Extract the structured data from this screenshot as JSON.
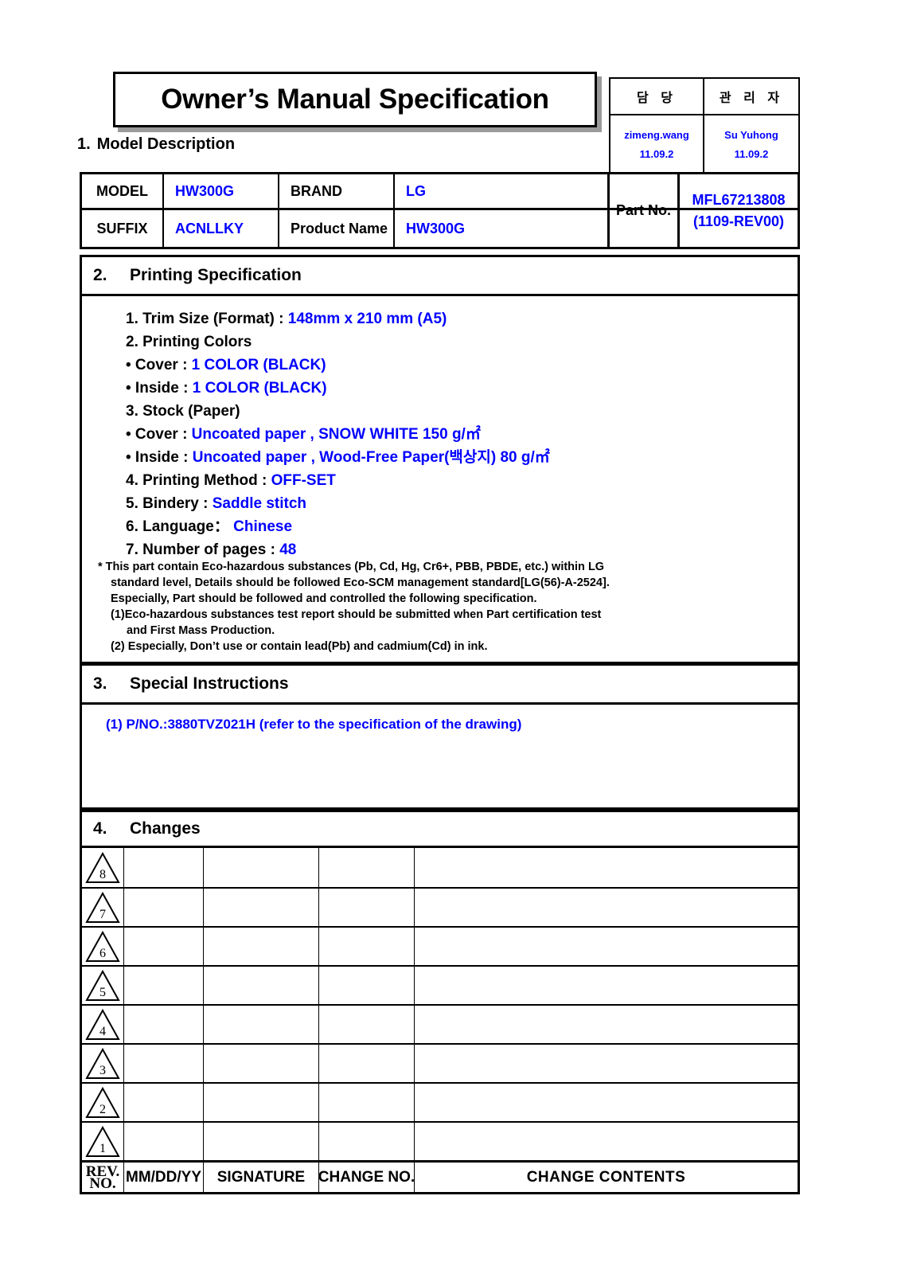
{
  "title": "Owner’s Manual Specification",
  "approval": {
    "columns": [
      {
        "header": "담 당",
        "name": "zimeng.wang",
        "date": "11.09.2"
      },
      {
        "header": "관 리 자",
        "name": "Su Yuhong",
        "date": "11.09.2"
      }
    ]
  },
  "section1": {
    "number": "1.",
    "heading": "Model Description",
    "model_label": "MODEL",
    "model_value": "HW300G",
    "brand_label": "BRAND",
    "brand_value": "LG",
    "suffix_label": "SUFFIX",
    "suffix_value": "ACNLLKY",
    "product_name_label": "Product Name",
    "product_name_value": "HW300G",
    "part_no_label": "Part No.",
    "part_no_value_1": "MFL67213808",
    "part_no_value_2": "(1109-REV00)"
  },
  "section2": {
    "number": "2.",
    "heading": "Printing Specification",
    "lines": [
      {
        "label": "1. Trim Size (Format) : ",
        "value": "148mm x 210 mm  (A5)"
      },
      {
        "label": "2. Printing Colors",
        "value": ""
      },
      {
        "label": "• Cover : ",
        "value": "1 COLOR (BLACK)"
      },
      {
        "label": "• Inside : ",
        "value": "1 COLOR (BLACK)"
      },
      {
        "label": "3. Stock (Paper)",
        "value": ""
      },
      {
        "label": "• Cover : ",
        "value": "Uncoated paper , SNOW WHITE 150 g/㎡"
      },
      {
        "label": "• Inside : ",
        "value": "Uncoated paper , Wood-Free Paper(백상지) 80 g/㎡"
      },
      {
        "label": "4. Printing Method : ",
        "value": "OFF-SET"
      },
      {
        "label": "5. Bindery  : ",
        "value": "Saddle stitch"
      },
      {
        "label": "6. Language： ",
        "value": "Chinese"
      },
      {
        "label": "7. Number of pages : ",
        "value": "48"
      }
    ],
    "eco_note": [
      "* This part contain Eco-hazardous substances (Pb, Cd, Hg, Cr6+, PBB, PBDE, etc.) within LG",
      "standard level, Details should be followed Eco-SCM management standard[LG(56)-A-2524].",
      "Especially, Part should be followed and controlled the following specification.",
      "(1)Eco-hazardous substances test report should be submitted when  Part certification test",
      "and First Mass Production.",
      "(2) Especially, Don’t use or contain lead(Pb) and cadmium(Cd) in ink."
    ]
  },
  "section3": {
    "number": "3.",
    "heading": "Special Instructions",
    "instruction": "(1) P/NO.:3880TVZ021H (refer to the specification of the drawing)"
  },
  "section4": {
    "number": "4.",
    "heading": "Changes",
    "revisions": [
      "8",
      "7",
      "6",
      "5",
      "4",
      "3",
      "2",
      "1"
    ],
    "footer": {
      "rev_line1": "REV.",
      "rev_line2": "NO.",
      "date": "MM/DD/YY",
      "signature": "SIGNATURE",
      "change_no": "CHANGE NO.",
      "contents": "CHANGE   CONTENTS"
    }
  },
  "colors": {
    "accent_blue": "#0000FF",
    "line_black": "#000000",
    "shadow_gray": "#9A9A9A"
  }
}
